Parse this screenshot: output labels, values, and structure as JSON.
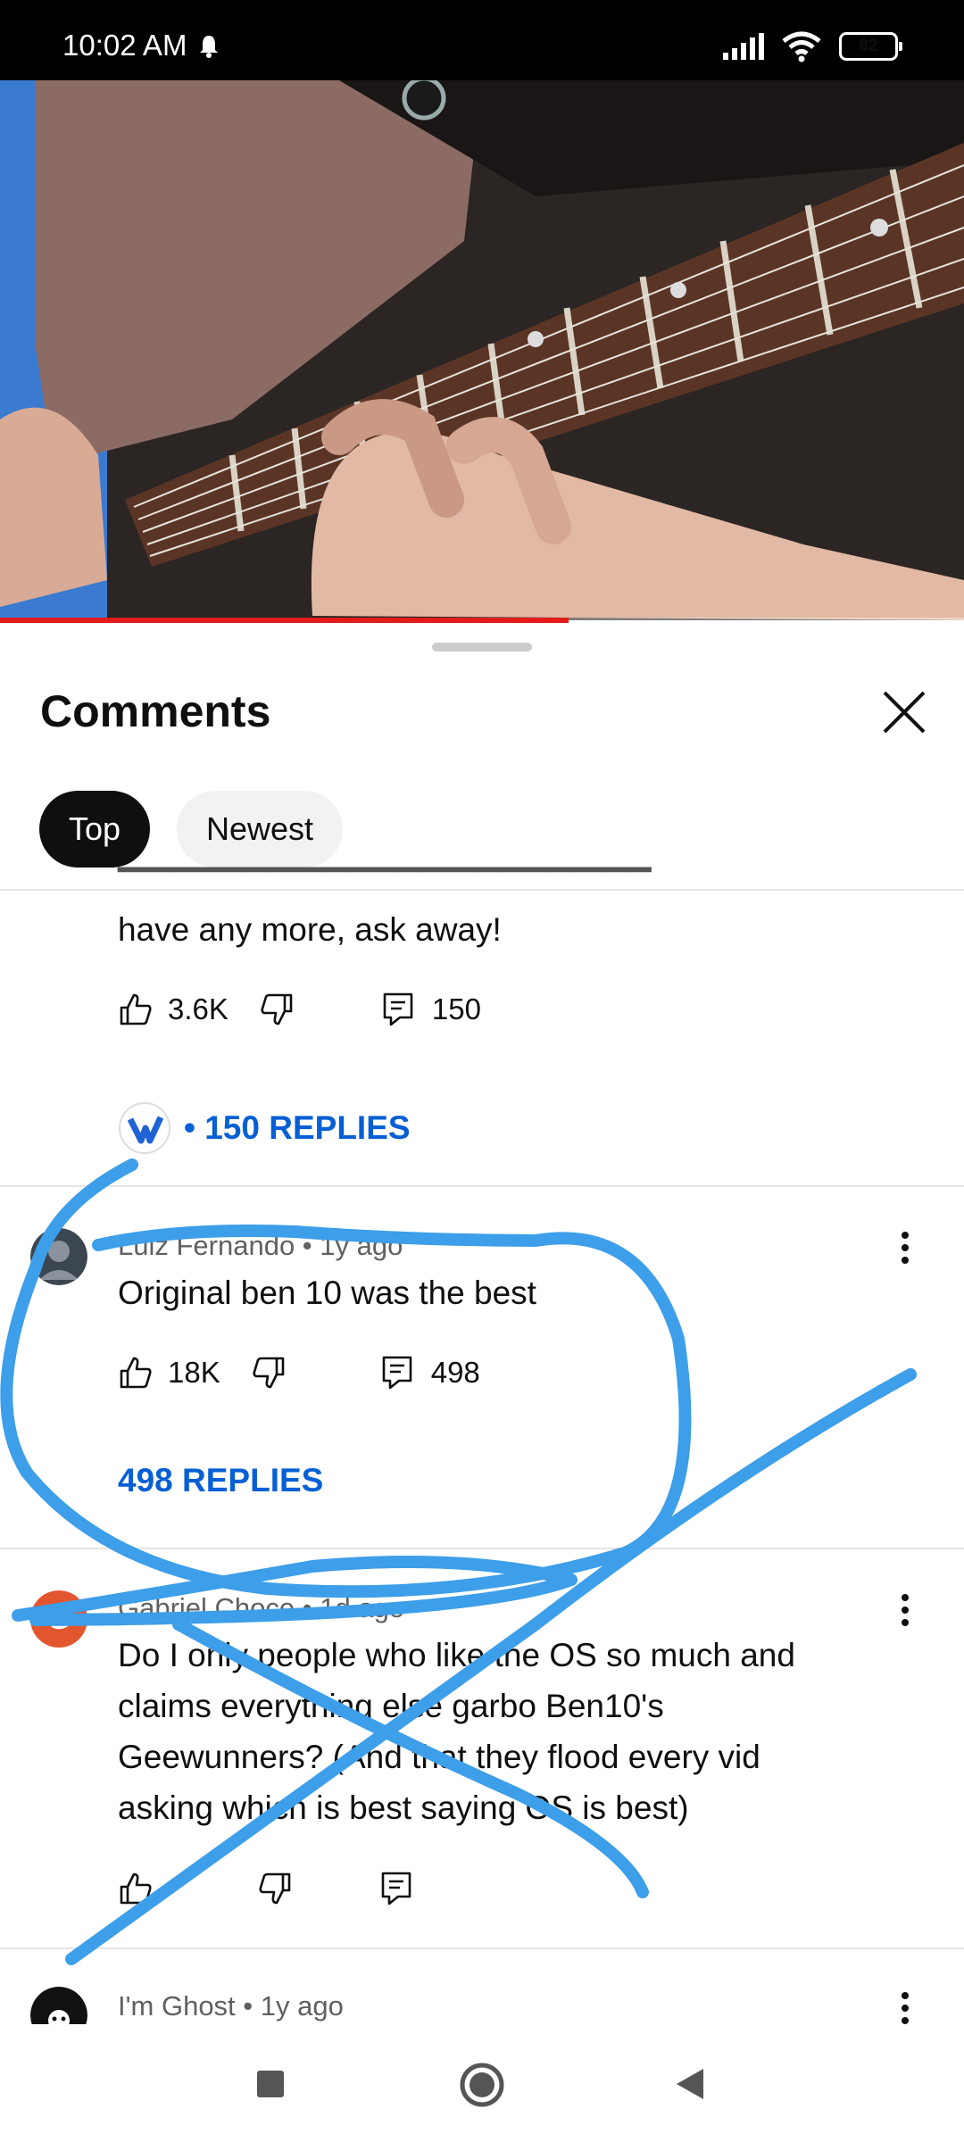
{
  "status_bar": {
    "time": "10:02 AM",
    "battery": "82"
  },
  "video": {
    "progress": 0.59
  },
  "sheet": {
    "title": "Comments"
  },
  "tabs": [
    {
      "label": "Top",
      "selected": true
    },
    {
      "label": "Newest",
      "selected": false
    }
  ],
  "comments": [
    {
      "text_tail": "have any more, ask away!",
      "likes": "3.6K",
      "reply_count": "150",
      "replies_label": "• 150 REPLIES"
    },
    {
      "meta": "Luiz Fernando • 1y ago",
      "text": "Original ben 10 was the best",
      "likes": "18K",
      "reply_count": "498",
      "replies_label": "498 REPLIES"
    },
    {
      "avatar_letter": "G",
      "meta": "Gabriel Choce • 1d ago",
      "lines": [
        "Do I only people who like the OS so much and",
        "claims everything else garbo  Ben10's",
        "Geewunners? (And that they flood every vid",
        "asking which is best saying OS is best)"
      ]
    },
    {
      "meta": "I'm Ghost • 1y ago"
    }
  ],
  "colors": {
    "accent_blue": "#065fd4",
    "scribble": "#3d9ee9",
    "progress_red": "#e21b1b"
  }
}
